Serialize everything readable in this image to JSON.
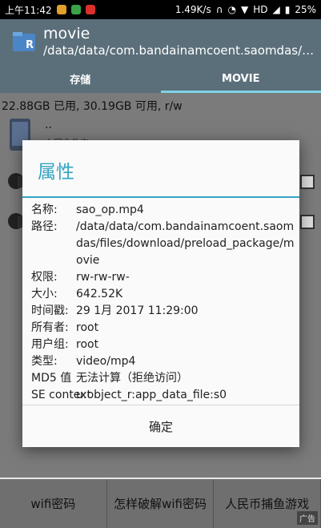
{
  "status_bar": {
    "time": "上午11:42",
    "speed": "1.49K/s",
    "hd": "HD",
    "battery": "25%"
  },
  "header": {
    "title": "movie",
    "path": "/data/data/com.bandainamcoent.saomdas/files/download/preload_package/movie"
  },
  "tabs": [
    {
      "label": "存储"
    },
    {
      "label": "MOVIE"
    }
  ],
  "storage_info": "22.88GB 已用, 30.19GB 可用, r/w",
  "parent_row": {
    "label": "..",
    "sub": "上层文件夹"
  },
  "dialog": {
    "title": "属性",
    "props": [
      {
        "key": "名称:",
        "value": "sao_op.mp4"
      },
      {
        "key": "路径:",
        "value": "/data/data/com.bandainamcoent.saomdas/files/download/preload_package/movie"
      },
      {
        "key": "权限:",
        "value": "rw-rw-rw-"
      },
      {
        "key": "大小:",
        "value": "642.52K"
      },
      {
        "key": "时间戳:",
        "value": "29 1月 2017 11:29:00"
      },
      {
        "key": "所有者:",
        "value": "root"
      },
      {
        "key": "用户组:",
        "value": "root"
      },
      {
        "key": "类型:",
        "value": "video/mp4"
      },
      {
        "key": "MD5 值",
        "value": "无法计算（拒绝访问）"
      },
      {
        "key": "SE context",
        "value": "u:object_r:app_data_file:s0"
      }
    ],
    "ok_label": "确定"
  },
  "bottom_buttons": [
    {
      "label": "wifi密码"
    },
    {
      "label": "怎样破解wifi密码"
    },
    {
      "label": "人民币捕鱼游戏"
    }
  ],
  "ad_badge": "广告",
  "colors": {
    "accent": "#35a4c4",
    "toolbar": "#5b6f7a"
  }
}
